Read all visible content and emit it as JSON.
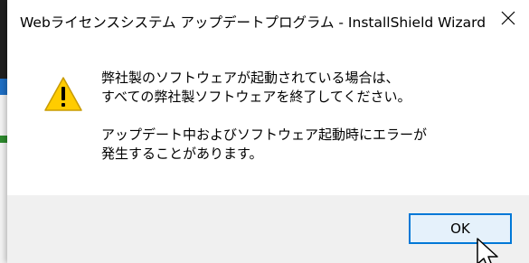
{
  "window": {
    "title": "Webライセンスシステム アップデートプログラム - InstallShield Wizard",
    "close_icon": "close-icon"
  },
  "message": {
    "icon": "warning-icon",
    "paragraph_1": "弊社製のソフトウェアが起動されている場合は、\nすべての弊社製ソフトウェアを終了してください。",
    "paragraph_2": "アップデート中およびソフトウェア起動時にエラーが\n発生することがあります。"
  },
  "buttons": {
    "ok_label": "OK"
  },
  "colors": {
    "accent": "#0078d7",
    "button_bg": "#e5f1fb",
    "footer_bg": "#f0f0f0",
    "warning_fill": "#ffcc00"
  }
}
